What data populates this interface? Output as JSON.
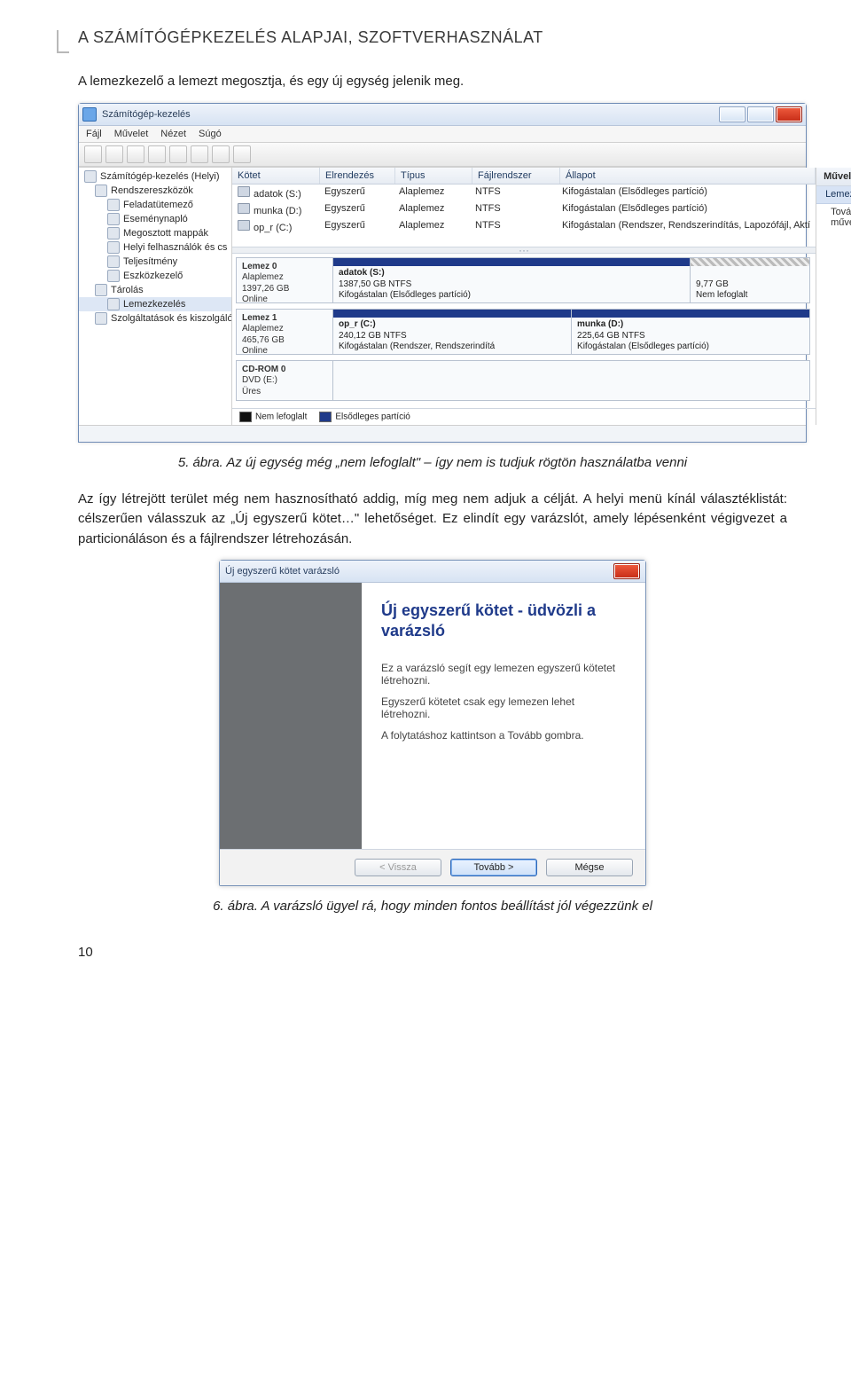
{
  "doc": {
    "header": "A SZÁMÍTÓGÉPKEZELÉS ALAPJAI, SZOFTVERHASZNÁLAT",
    "intro": "A lemezkezelő a lemezt megosztja, és egy új egység jelenik meg.",
    "caption1": "5. ábra. Az új egység még „nem lefoglalt\" – így nem is tudjuk rögtön használatba venni",
    "para1": "Az így létrejött terület még nem hasznosítható addig, míg meg nem adjuk a célját. A helyi menü kínál választéklistát: célszerűen válasszuk az „Új egyszerű kötet…\" lehetőséget. Ez elindít egy varázslót, amely lépésenként végigvezet a particionáláson és a fájlrendszer létrehozásán.",
    "caption2": "6. ábra. A varázsló ügyel rá, hogy minden fontos beállítást jól végezzünk el",
    "page_number": "10"
  },
  "mmc": {
    "title": "Számítógép-kezelés",
    "menu": [
      "Fájl",
      "Művelet",
      "Nézet",
      "Súgó"
    ],
    "tree": [
      {
        "label": "Számítógép-kezelés (Helyi)",
        "ind": 0,
        "sel": false
      },
      {
        "label": "Rendszereszközök",
        "ind": 1,
        "sel": false
      },
      {
        "label": "Feladatütemező",
        "ind": 2,
        "sel": false
      },
      {
        "label": "Eseménynapló",
        "ind": 2,
        "sel": false
      },
      {
        "label": "Megosztott mappák",
        "ind": 2,
        "sel": false
      },
      {
        "label": "Helyi felhasználók és cs",
        "ind": 2,
        "sel": false
      },
      {
        "label": "Teljesítmény",
        "ind": 2,
        "sel": false
      },
      {
        "label": "Eszközkezelő",
        "ind": 2,
        "sel": false
      },
      {
        "label": "Tárolás",
        "ind": 1,
        "sel": false
      },
      {
        "label": "Lemezkezelés",
        "ind": 2,
        "sel": true
      },
      {
        "label": "Szolgáltatások és kiszolgáló",
        "ind": 1,
        "sel": false
      }
    ],
    "vol_headers": [
      "Kötet",
      "Elrendezés",
      "Típus",
      "Fájlrendszer",
      "Állapot"
    ],
    "vol_rows": [
      {
        "c1": "adatok (S:)",
        "c2": "Egyszerű",
        "c3": "Alaplemez",
        "c4": "NTFS",
        "c5": "Kifogástalan (Elsődleges partíció)"
      },
      {
        "c1": "munka (D:)",
        "c2": "Egyszerű",
        "c3": "Alaplemez",
        "c4": "NTFS",
        "c5": "Kifogástalan (Elsődleges partíció)"
      },
      {
        "c1": "op_r (C:)",
        "c2": "Egyszerű",
        "c3": "Alaplemez",
        "c4": "NTFS",
        "c5": "Kifogástalan (Rendszer, Rendszerindítás, Lapozófájl, Aktí"
      }
    ],
    "disks": [
      {
        "title": "Lemez 0",
        "lines": [
          "Alaplemez",
          "1397,26 GB",
          "Online"
        ],
        "parts": [
          {
            "strip": "blue",
            "name": "adatok (S:)",
            "l2": "1387,50 GB NTFS",
            "l3": "Kifogástalan (Elsődleges partíció)"
          },
          {
            "strip": "hatch",
            "name": "",
            "l2": "9,77 GB",
            "l3": "Nem lefoglalt"
          }
        ]
      },
      {
        "title": "Lemez 1",
        "lines": [
          "Alaplemez",
          "465,76 GB",
          "Online"
        ],
        "parts": [
          {
            "strip": "blue",
            "name": "op_r (C:)",
            "l2": "240,12 GB NTFS",
            "l3": "Kifogástalan (Rendszer, Rendszerindítá"
          },
          {
            "strip": "blue",
            "name": "munka (D:)",
            "l2": "225,64 GB NTFS",
            "l3": "Kifogástalan (Elsődleges partíció)"
          }
        ]
      },
      {
        "title": "CD-ROM 0",
        "lines": [
          "DVD (E:)",
          "",
          "Üres"
        ],
        "parts": []
      }
    ],
    "legend": {
      "a": "Nem lefoglalt",
      "b": "Elsődleges partíció"
    },
    "actions": {
      "title": "Műveletek",
      "sel": "Lemezkezelés",
      "more": "További műveletek",
      "arrow": "▸",
      "up": "▴"
    }
  },
  "wizard": {
    "title": "Új egyszerű kötet varázsló",
    "heading": "Új egyszerű kötet - üdvözli a varázsló",
    "line1": "Ez a varázsló segít egy lemezen egyszerű kötetet létrehozni.",
    "line2": "Egyszerű kötetet csak egy lemezen lehet létrehozni.",
    "line3": "A folytatáshoz kattintson a Tovább gombra.",
    "back": "< Vissza",
    "next": "Tovább >",
    "cancel": "Mégse"
  }
}
